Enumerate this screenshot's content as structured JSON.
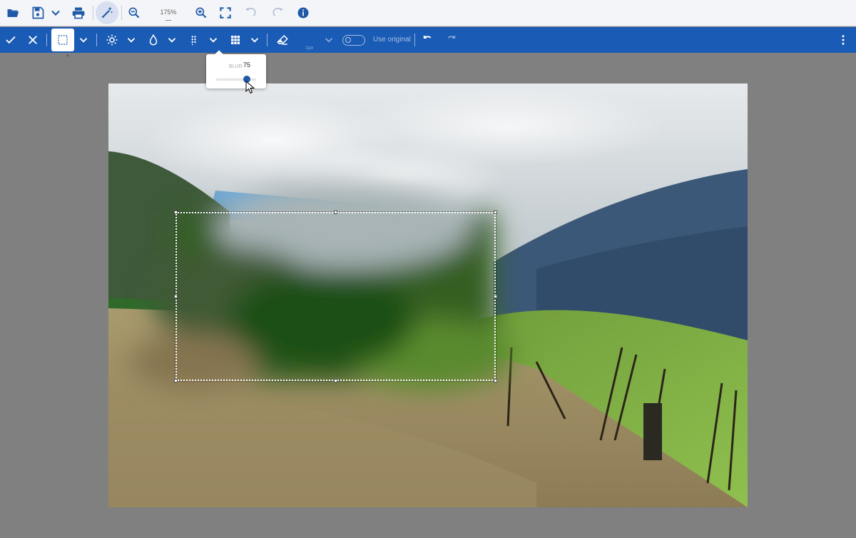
{
  "top_toolbar": {
    "icons": [
      "folder-open-icon",
      "save-icon",
      "chevron-down-icon",
      "print-icon",
      "magic-wand-icon",
      "zoom-out-icon",
      "zoom-in-icon",
      "fit-screen-icon",
      "undo-icon",
      "redo-icon",
      "info-icon"
    ],
    "zoom_level": "175%"
  },
  "edit_toolbar": {
    "icons": [
      "check-icon",
      "close-icon",
      "rect-select-icon",
      "chevron-down-icon",
      "brightness-icon",
      "drop-icon",
      "dots-pattern-icon",
      "grid-icon",
      "eraser-icon",
      "undo-icon",
      "redo-icon",
      "more-vert-icon"
    ],
    "brush_size": "1px",
    "use_original_label": "Use original",
    "use_original_enabled": false
  },
  "blur_popup": {
    "label": "BLUR",
    "value": "75",
    "slider_value": 75
  },
  "colors": {
    "toolbar_bg": "#f4f5f8",
    "edit_bar_bg": "#1a5bb5",
    "workspace_bg": "#808080",
    "accent": "#1f5aa8"
  }
}
